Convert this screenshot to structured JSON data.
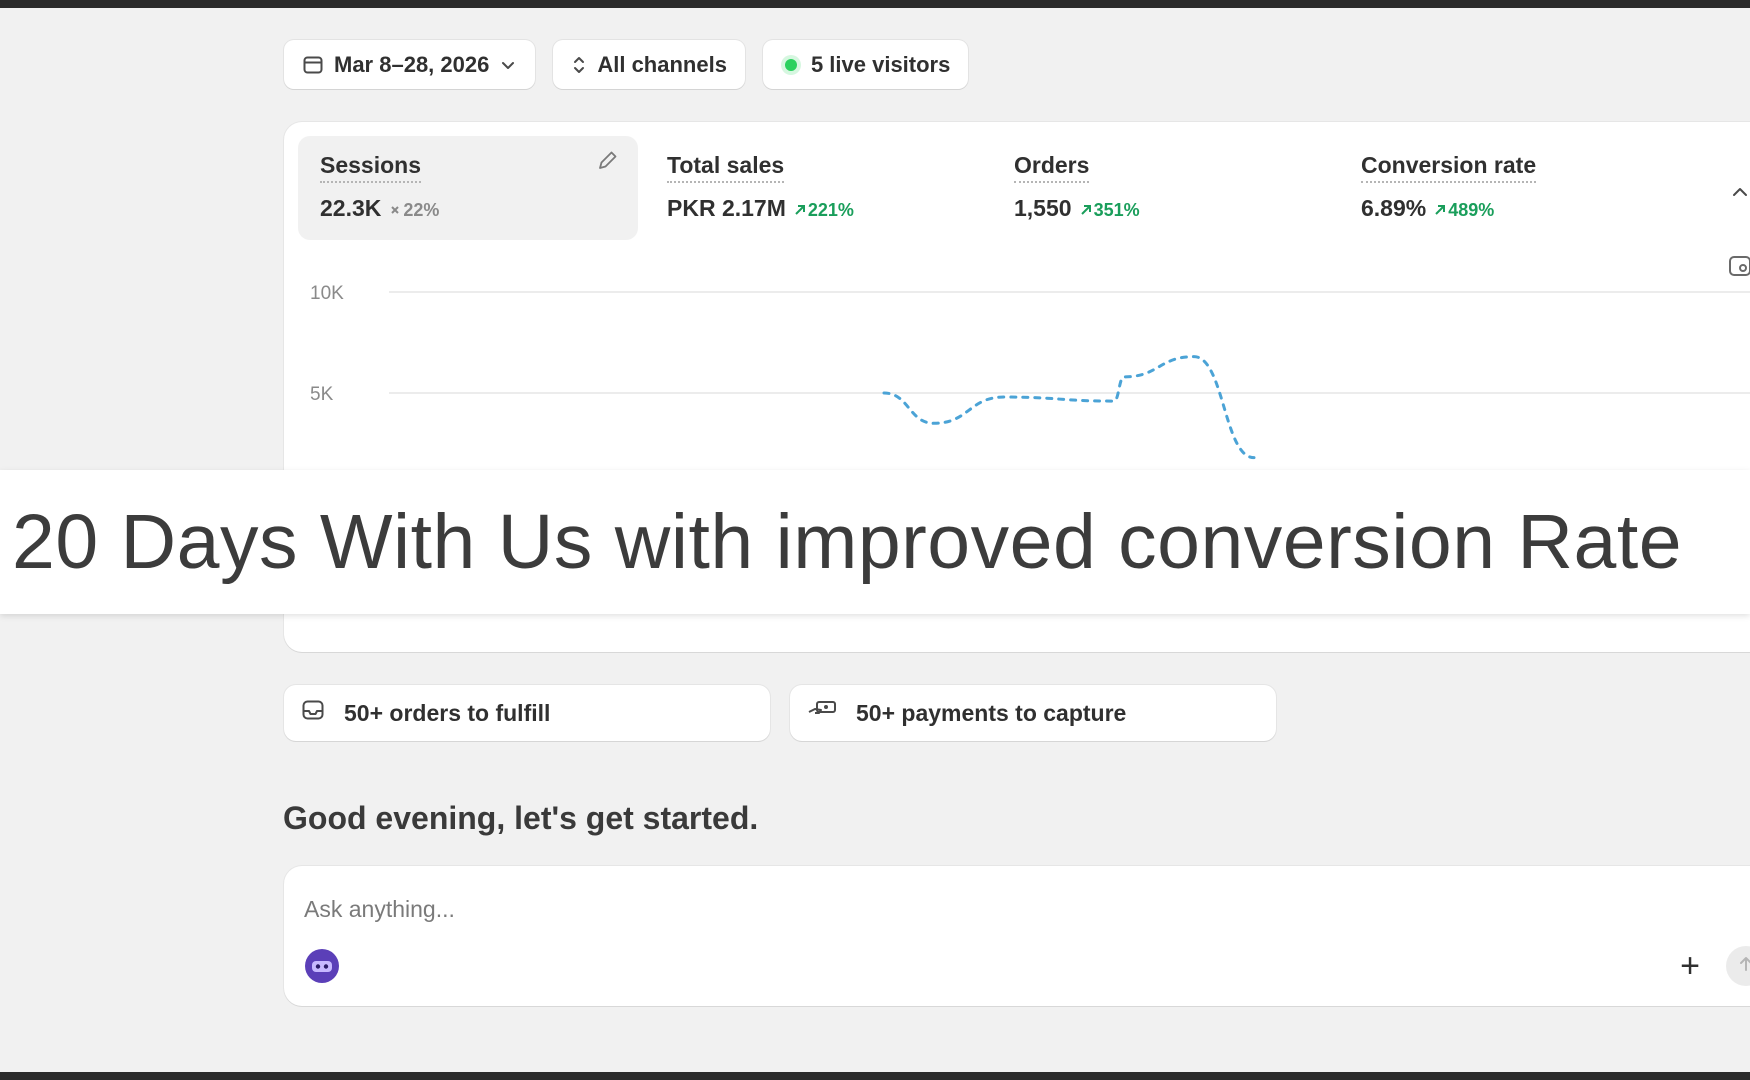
{
  "filters": {
    "date_range": "Mar 8–28, 2026",
    "channels": "All channels",
    "live_visitors": "5 live visitors"
  },
  "metrics": [
    {
      "label": "Sessions",
      "value": "22.3K",
      "delta": "22%",
      "trend": "neutral"
    },
    {
      "label": "Total sales",
      "value": "PKR 2.17M",
      "delta": "221%",
      "trend": "up"
    },
    {
      "label": "Orders",
      "value": "1,550",
      "delta": "351%",
      "trend": "up"
    },
    {
      "label": "Conversion rate",
      "value": "6.89%",
      "delta": "489%",
      "trend": "up"
    }
  ],
  "chart_data": {
    "type": "line",
    "yticks": [
      "10K",
      "5K"
    ],
    "ylim": [
      0,
      10000
    ],
    "grid": true,
    "series": [
      {
        "values": [
          5000,
          3500,
          4800,
          4600,
          5800,
          6800,
          1800
        ],
        "style": "dashed"
      }
    ]
  },
  "banner": {
    "text": "20 Days With Us with improved conversion Rate"
  },
  "tasks": [
    {
      "label": "50+ orders to fulfill",
      "icon": "inbox-icon"
    },
    {
      "label": "50+ payments to capture",
      "icon": "cash-icon"
    }
  ],
  "greeting": "Good evening, let's get started.",
  "ask": {
    "placeholder": "Ask anything...",
    "plus": "+"
  },
  "colors": {
    "accent_green": "#1a9e5b",
    "live_dot": "#2bd15e",
    "series_blue": "#4ba3d6",
    "background": "#f1f1f1"
  }
}
